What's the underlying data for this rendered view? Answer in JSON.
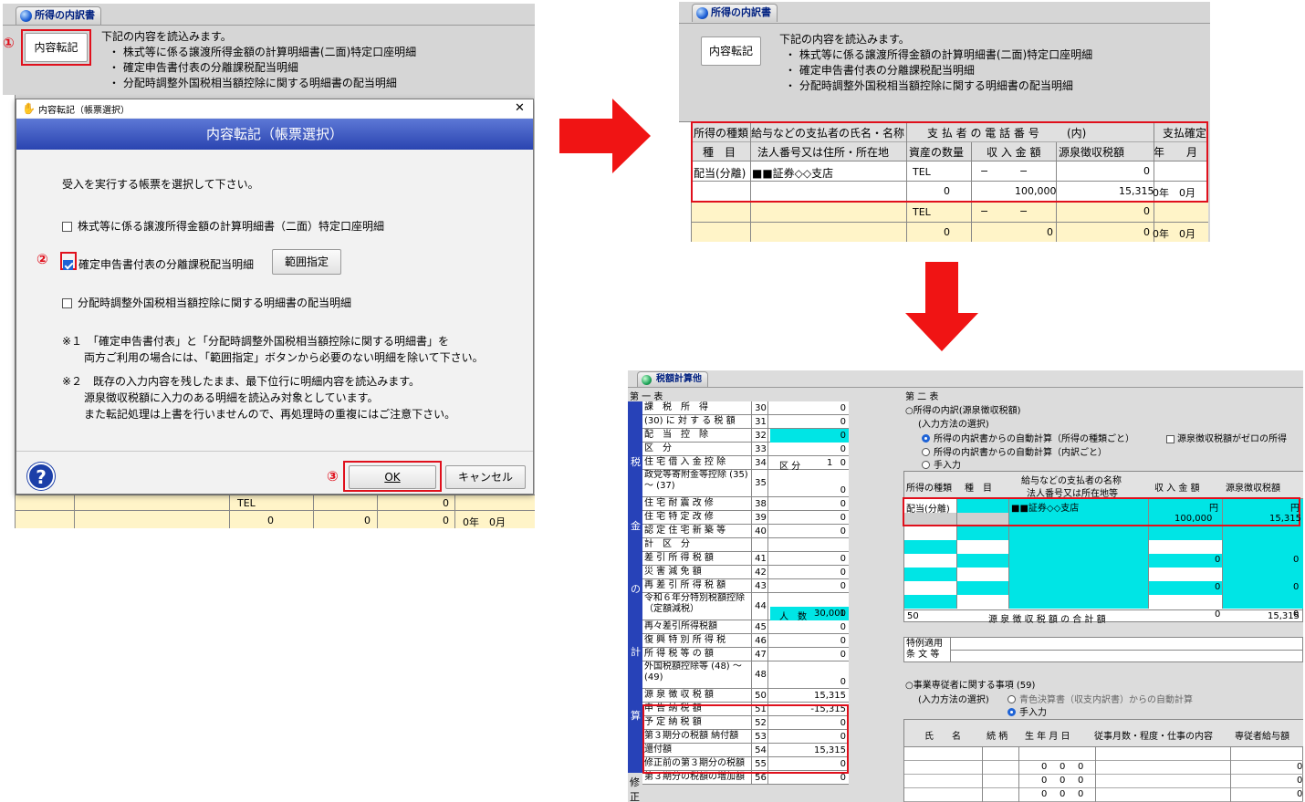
{
  "p1": {
    "tab": "所得の内訳書",
    "btn": "内容転記",
    "m1": "①",
    "intro": "下記の内容を読込みます。",
    "items": [
      "・ 株式等に係る譲渡所得金額の計算明細書(二面)特定口座明細",
      "・ 確定申告書付表の分離課税配当明細",
      "・ 分配時調整外国税相当額控除に関する明細書の配当明細"
    ]
  },
  "dlg": {
    "title_small": "内容転記（帳票選択）",
    "close": "✕",
    "header": "内容転記（帳票選択）",
    "prompt": "受入を実行する帳票を選択して下さい。",
    "opt1": "株式等に係る譲渡所得金額の計算明細書（二面）特定口座明細",
    "opt2": "確定申告書付表の分離課税配当明細",
    "opt3": "分配時調整外国税相当額控除に関する明細書の配当明細",
    "m2": "②",
    "range_btn": "範囲指定",
    "note1a": "※１　「確定申告書付表」と「分配時調整外国税相当額控除に関する明細書」を",
    "note1b": "両方ご利用の場合には、「範囲指定」ボタンから必要のない明細を除いて下さい。",
    "note2a": "※２　既存の入力内容を残したまま、最下位行に明細内容を読込みます。",
    "note2b": "源泉徴収税額に入力のある明細を読込み対象としています。",
    "note2c": "また転記処理は上書を行いませんので、再処理時の重複にはご注意下さい。",
    "help": "?",
    "m3": "③",
    "ok": "OK",
    "cancel": "キャンセル",
    "bg_tel": "TEL",
    "bg_vals": [
      "0",
      "0",
      "0",
      "0"
    ],
    "bg_date": "0年　0月"
  },
  "p2": {
    "tab": "所得の内訳書",
    "btn": "内容転記",
    "intro": "下記の内容を読込みます。",
    "items": [
      "・ 株式等に係る譲渡所得金額の計算明細書(二面)特定口座明細",
      "・ 確定申告書付表の分離課税配当明細",
      "・ 分配時調整外国税相当額控除に関する明細書の配当明細"
    ],
    "h1": [
      "所得の種類",
      "給与などの支払者の氏名・名称",
      "支 払 者 の 電 話 番 号",
      "(内)",
      "支払確定"
    ],
    "h2": [
      "種　目",
      "法人番号又は住所・所在地",
      "資産の数量",
      "収 入 金 額",
      "源泉徴収税額",
      "年　　月"
    ],
    "r1": {
      "kind": "配当(分離)",
      "name": "■■証券◇◇支店",
      "tel": "TEL",
      "dash1": "−",
      "dash2": "−",
      "v0": "0"
    },
    "r2": {
      "qty": "0",
      "income": "100,000",
      "tax": "15,315",
      "date": "0年　0月"
    },
    "r3": {
      "tel": "TEL",
      "dash1": "−",
      "dash2": "−",
      "v0": "0"
    },
    "r4": {
      "qty": "0",
      "income": "0",
      "tax": "0",
      "date": "0年　0月"
    }
  },
  "p3": {
    "tab": "税額計算他",
    "t1": "第 一 表",
    "side": [
      "税",
      "金",
      "の",
      "計",
      "算"
    ],
    "side2": [
      "修",
      "正"
    ],
    "rows": [
      [
        "課　税　所　得",
        "30",
        "0"
      ],
      [
        "(30) に 対 す る 税 額",
        "31",
        "0"
      ],
      [
        "配　当　控　除",
        "32",
        "0"
      ],
      [
        "区　分",
        "33",
        "0"
      ],
      [
        "住 宅 借 入 金 控 除",
        "34",
        "0"
      ],
      [
        "政党等寄附金等控除 (35) 〜 (37)",
        "35",
        "0"
      ],
      [
        "住 宅 耐 震 改 修",
        "38",
        "0"
      ],
      [
        "住 宅 特 定 改 修",
        "39",
        "0"
      ],
      [
        "認 定 住 宅 新 築 等",
        "40",
        "0"
      ],
      [
        "計　区　分",
        "",
        ""
      ],
      [
        "差 引 所 得 税 額",
        "41",
        "0"
      ],
      [
        "災 害 減 免 額",
        "42",
        "0"
      ],
      [
        "再 差 引 所 得 税 額",
        "43",
        "0"
      ],
      [
        "令和６年分特別税額控除（定額減税）",
        "44",
        "30,000"
      ],
      [
        "再々差引所得税額",
        "45",
        "0"
      ],
      [
        "復 興 特 別 所 得 税",
        "46",
        "0"
      ],
      [
        "所 得 税 等 の 額",
        "47",
        "0"
      ],
      [
        "外国税額控除等 (48) 〜 (49)",
        "48",
        "0"
      ],
      [
        "源 泉 徴 収 税 額",
        "50",
        "15,315"
      ],
      [
        "申 告 納 税 額",
        "51",
        "-15,315"
      ],
      [
        "予 定 納 税 額",
        "52",
        "0"
      ],
      [
        "第３期分の税額 納付額",
        "53",
        "0"
      ],
      [
        "還付額",
        "54",
        "15,315"
      ],
      [
        "修正前の第３期分の税額",
        "55",
        "0"
      ],
      [
        "第３期分の税額の増加額",
        "56",
        "0"
      ]
    ],
    "kubun2": "区 分 ２",
    "kubun2_chk": "年調適用",
    "kubun": "区 分",
    "kubun_val": "1",
    "jin": "人　数",
    "jin_val": "1",
    "t2": "第 二 表",
    "s1": "○所得の内訳(源泉徴収税額)",
    "s1b": "(入力方法の選択)",
    "r_auto1": "所得の内訳書からの自動計算（所得の種類ごと）",
    "r_zero": "源泉徴収税額がゼロの所得",
    "r_auto2": "所得の内訳書からの自動計算（内訳ごと）",
    "r_manual": "手入力",
    "th": [
      "所得の種類",
      "種　目",
      "給与などの支払者の名称",
      "法人番号又は所在地等",
      "収 入 金 額",
      "源泉徴収税額"
    ],
    "yen": "円",
    "d_kind": "配当(分離)",
    "d_name": "■■証券◇◇支店",
    "d_income": "100,000",
    "d_tax": "15,315",
    "zeros": "0",
    "sum_no": "50",
    "sum_label": "源 泉 徴 収 税 額 の 合 計 額",
    "sum_val": "15,315",
    "tokurei": "特例適用条 文 等",
    "s2": "○事業専従者に関する事項 (59)",
    "s2b": "(入力方法の選択)",
    "r_aoiro": "青色決算書（収支内訳書）からの自動計算",
    "r_manual2": "手入力",
    "th2": [
      "氏　　名",
      "続 柄",
      "生 年 月 日",
      "従事月数・程度・仕事の内容",
      "専従者給与額"
    ]
  }
}
